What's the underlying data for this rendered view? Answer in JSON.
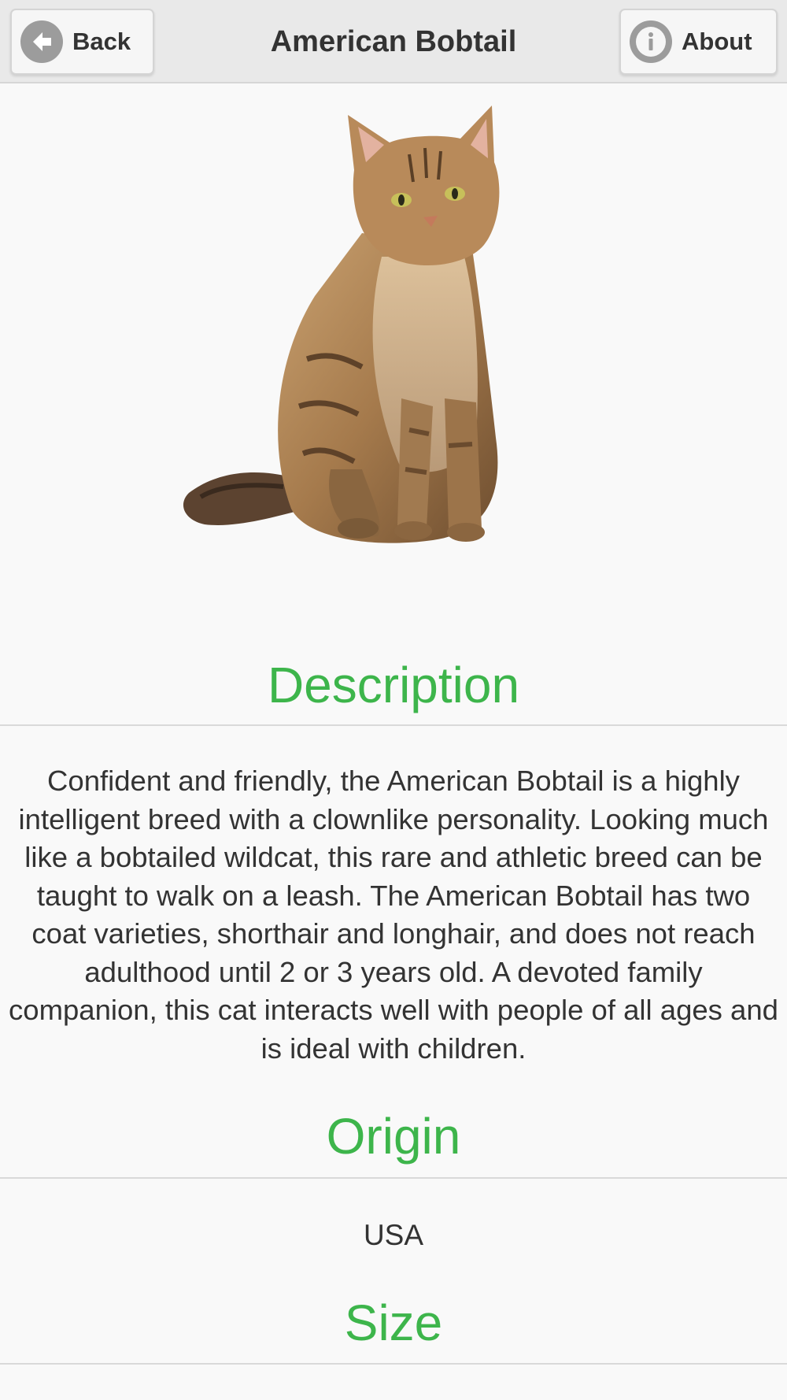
{
  "header": {
    "title": "American Bobtail",
    "back_label": "Back",
    "about_label": "About"
  },
  "icons": {
    "back": "arrow-left-circle-icon",
    "about": "info-circle-icon"
  },
  "image": {
    "subject": "cat-photo"
  },
  "sections": {
    "description": {
      "title": "Description",
      "text": "Confident and friendly, the American Bobtail is a highly intelligent breed with a clownlike personality. Looking much like a bobtailed wildcat, this rare and athletic breed can be taught to walk on a leash. The American Bobtail has two coat varieties, shorthair and longhair, and does not reach adulthood until 2 or 3 years old. A devoted family companion, this cat interacts well with people of all ages and is ideal with children."
    },
    "origin": {
      "title": "Origin",
      "value": "USA"
    },
    "size": {
      "title": "Size"
    }
  },
  "colors": {
    "accent": "#3db54b",
    "header_bg": "#e9e9e9",
    "page_bg": "#f9f9f9",
    "icon_gray": "#9c9c9c"
  }
}
